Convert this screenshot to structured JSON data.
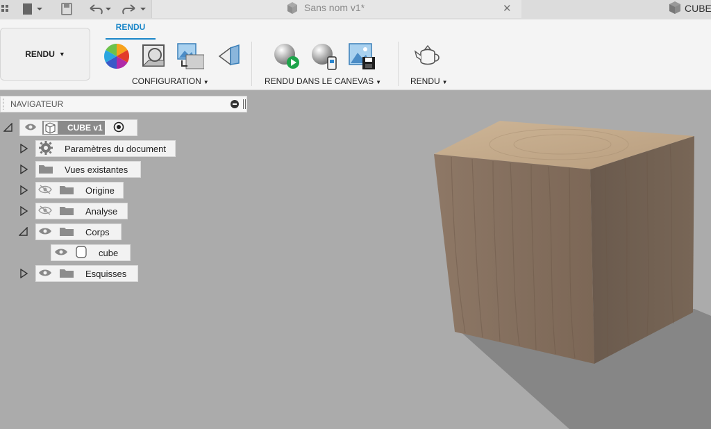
{
  "titlebar": {
    "doc_tab_title": "Sans nom v1*",
    "cube_tab_title": "CUBE",
    "close_glyph": "✕"
  },
  "toolbar": {
    "workspace_label": "RENDU",
    "active_tab": "RENDU",
    "groups": {
      "configuration": "CONFIGURATION",
      "canvas_render": "RENDU DANS LE CANEVAS",
      "render": "RENDU"
    }
  },
  "navigator": {
    "title": "NAVIGATEUR",
    "root": "CUBE v1",
    "items": [
      {
        "label": "Paramètres du document"
      },
      {
        "label": "Vues existantes"
      },
      {
        "label": "Origine"
      },
      {
        "label": "Analyse"
      },
      {
        "label": "Corps"
      },
      {
        "label": "cube"
      },
      {
        "label": "Esquisses"
      }
    ]
  },
  "colors": {
    "accent": "#1a86c8",
    "canvas": "#aaaaaa",
    "wood_top": "#c4ab8c",
    "wood_front": "#8a7462",
    "wood_side": "#6e5d50"
  }
}
